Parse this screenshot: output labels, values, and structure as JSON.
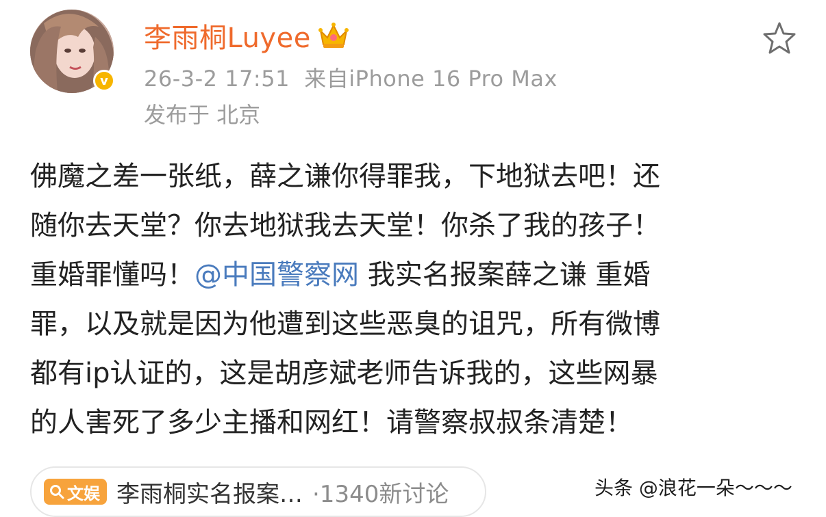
{
  "user": {
    "name": "李雨桐Luyee",
    "avatar_icon": "profile-photo",
    "verified_icon": "verified-v-badge",
    "verified_mark": "v",
    "crown_icon": "crown-icon",
    "name_color": "#ef6a2c"
  },
  "post": {
    "time": "26-3-2 17:51",
    "source": "来自iPhone 16 Pro Max",
    "location": "发布于 北京",
    "lines": [
      {
        "text": "佛魔之差一张纸，薛之谦你得罪我，下地狱去吧！还"
      },
      {
        "text": "随你去天堂？你去地狱我去天堂！你杀了我的孩子！"
      },
      {
        "before": "重婚罪懂吗！",
        "mention": "@中国警察网",
        "after": " 我实名报案薛之谦 重婚"
      },
      {
        "text": "罪，以及就是因为他遭到这些恶臭的诅咒，所有微博"
      },
      {
        "text": "都有ip认证的，这是胡彦斌老师告诉我的，这些网暴"
      },
      {
        "text": "的人害死了多少主播和网红！请警察叔叔条清楚！"
      }
    ],
    "mention_color": "#4a7bbd"
  },
  "actions": {
    "favorite_icon": "star-outline-icon"
  },
  "topic": {
    "badge": "文娱",
    "badge_icon": "search-icon",
    "title": "李雨桐实名报案…",
    "count": "·1340新讨论"
  },
  "watermark": "头条 @浪花一朵～～～"
}
